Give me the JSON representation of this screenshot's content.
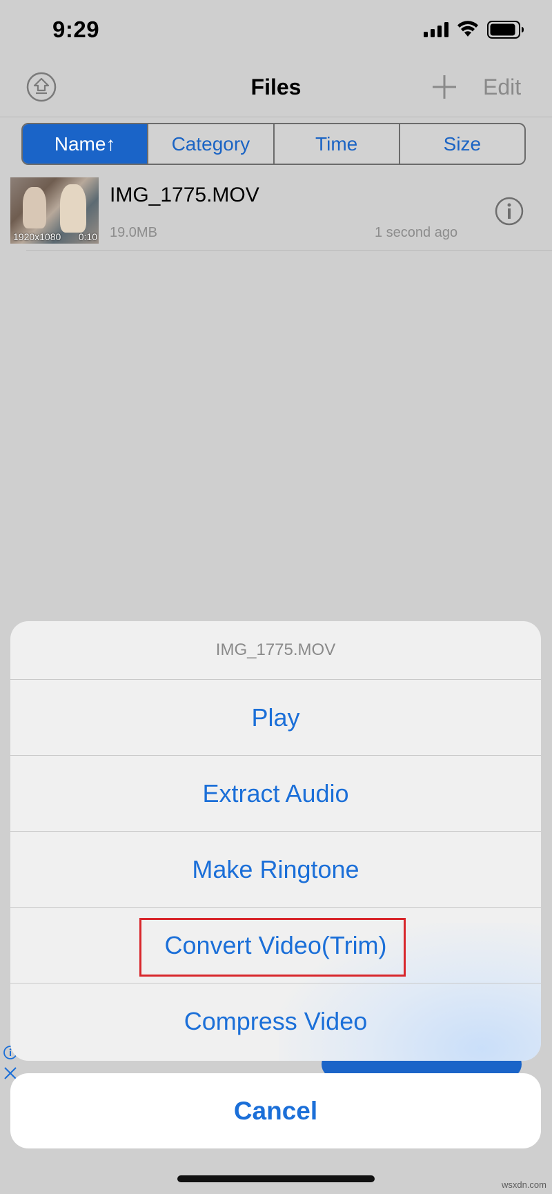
{
  "status_bar": {
    "time": "9:29"
  },
  "nav": {
    "title": "Files",
    "edit_label": "Edit"
  },
  "sort_tabs": [
    {
      "label": "Name↑",
      "active": true
    },
    {
      "label": "Category",
      "active": false
    },
    {
      "label": "Time",
      "active": false
    },
    {
      "label": "Size",
      "active": false
    }
  ],
  "file": {
    "name": "IMG_1775.MOV",
    "size": "19.0MB",
    "modified": "1 second ago",
    "resolution": "1920x1080",
    "duration": "0:10"
  },
  "action_sheet": {
    "title": "IMG_1775.MOV",
    "actions": [
      "Play",
      "Extract Audio",
      "Make Ringtone",
      "Convert Video(Trim)",
      "Compress Video"
    ],
    "highlighted_action": "Convert Video(Trim)",
    "cancel_label": "Cancel"
  },
  "watermark": "wsxdn.com",
  "colors": {
    "accent": "#1b6fd8",
    "highlight": "#d8262b",
    "segment_active": "#1a64c8"
  },
  "icons": [
    "signal-icon",
    "wifi-icon",
    "battery-icon",
    "upload-icon",
    "plus-icon",
    "info-icon",
    "close-icon"
  ]
}
